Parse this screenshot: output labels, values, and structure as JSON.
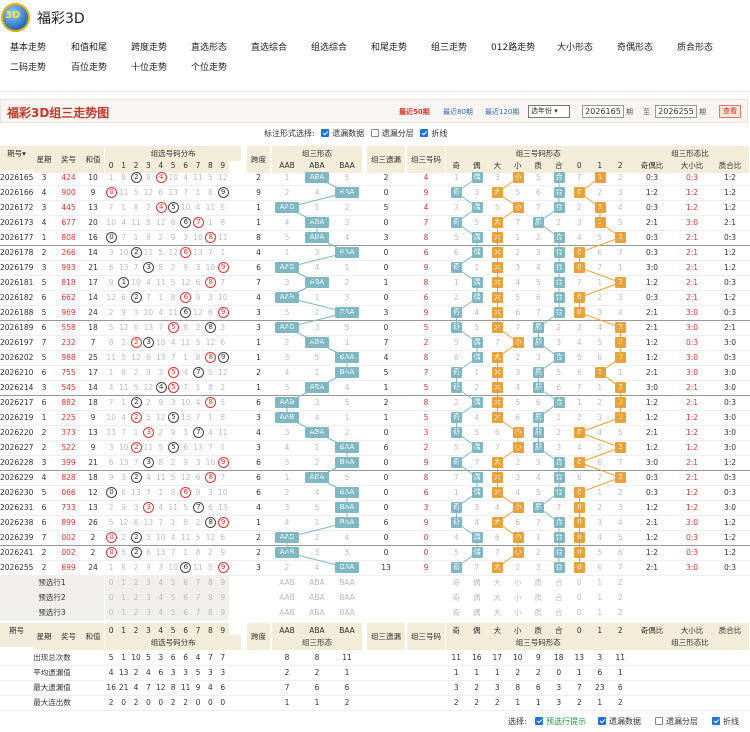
{
  "app": {
    "logo_text": "3D",
    "title": "福彩3D"
  },
  "nav": [
    [
      "基本走势",
      10,
      0
    ],
    [
      "和值和尾",
      71,
      0
    ],
    [
      "跨度走势",
      131,
      0
    ],
    [
      "直选形态",
      191,
      0
    ],
    [
      "直选综合",
      251,
      0
    ],
    [
      "组选综合",
      311,
      0
    ],
    [
      "和尾走势",
      371,
      0
    ],
    [
      "组三走势",
      431,
      0
    ],
    [
      "012路走势",
      491,
      0
    ],
    [
      "大小形态",
      557,
      0
    ],
    [
      "奇偶形态",
      617,
      0
    ],
    [
      "质合形态",
      677,
      0
    ],
    [
      "二码走势",
      10,
      1
    ],
    [
      "百位走势",
      71,
      1
    ],
    [
      "十位走势",
      131,
      1
    ],
    [
      "个位走势",
      191,
      1
    ]
  ],
  "toolbar": {
    "chart_title": "福彩3D组三走势图",
    "periods": [
      "最近50期",
      "最近80期",
      "最近120期"
    ],
    "year_select": "选年份",
    "from": "2026165",
    "to_label": "期",
    "between": "至",
    "to": "2026255",
    "end_label": "期",
    "query": "查看"
  },
  "options": {
    "label": "标注形式选择:",
    "items": [
      {
        "label": "遗漏数据",
        "on": true
      },
      {
        "label": "遗漏分层",
        "on": false
      },
      {
        "label": "折线",
        "on": true
      }
    ]
  },
  "headers": {
    "period": "期号",
    "week": "星期",
    "prize": "奖号",
    "sum": "和值",
    "dist": "组选号码分布",
    "span": "跨度",
    "shape": "组三形态",
    "shape_cols": [
      "AAB",
      "ABA",
      "BAA"
    ],
    "omit": "组三遗漏",
    "code": "组三号码",
    "code_shape": "组三号码形态",
    "code_cols": [
      "奇",
      "偶",
      "大",
      "小",
      "质",
      "合",
      "0",
      "1",
      "2"
    ],
    "ratio": "组三形态比",
    "ratio_cols": [
      "奇偶比",
      "大小比",
      "质合比"
    ]
  },
  "rows": [
    [
      "2026165",
      "3",
      "424",
      "10",
      "2",
      "ABA",
      "2",
      "4",
      "0:3",
      "0:3",
      "1:2"
    ],
    [
      "2026166",
      "4",
      "900",
      "9",
      "9",
      "BAA",
      "0",
      "9",
      "1:2",
      "1:2",
      "1:2"
    ],
    [
      "2026172",
      "3",
      "445",
      "13",
      "1",
      "AAB",
      "5",
      "4",
      "0:3",
      "1:2",
      "1:2"
    ],
    [
      "2026173",
      "4",
      "677",
      "20",
      "1",
      "ABA",
      "0",
      "7",
      "2:1",
      "3:0",
      "2:1"
    ],
    [
      "2026177",
      "1",
      "808",
      "16",
      "8",
      "ABA",
      "3",
      "8",
      "0:3",
      "2:1",
      "0:3"
    ],
    [
      "2026178",
      "2",
      "266",
      "14",
      "4",
      "BAA",
      "0",
      "6",
      "0:3",
      "2:1",
      "1:2"
    ],
    [
      "2026179",
      "3",
      "993",
      "21",
      "6",
      "AAB",
      "0",
      "9",
      "3:0",
      "2:1",
      "1:2"
    ],
    [
      "2026181",
      "5",
      "818",
      "17",
      "7",
      "ABA",
      "1",
      "8",
      "1:2",
      "2:1",
      "0:3"
    ],
    [
      "2026182",
      "6",
      "662",
      "14",
      "4",
      "AAB",
      "0",
      "6",
      "0:3",
      "2:1",
      "1:2"
    ],
    [
      "2026188",
      "5",
      "969",
      "24",
      "3",
      "BAA",
      "3",
      "9",
      "2:1",
      "3:0",
      "0:3"
    ],
    [
      "2026189",
      "6",
      "558",
      "18",
      "3",
      "AAB",
      "0",
      "5",
      "2:1",
      "3:0",
      "2:1"
    ],
    [
      "2026197",
      "7",
      "232",
      "7",
      "1",
      "ABA",
      "7",
      "2",
      "1:2",
      "0:3",
      "3:0"
    ],
    [
      "2026202",
      "5",
      "988",
      "25",
      "1",
      "BAA",
      "4",
      "8",
      "1:2",
      "3:0",
      "0:3"
    ],
    [
      "2026210",
      "6",
      "755",
      "17",
      "2",
      "BAA",
      "5",
      "7",
      "2:1",
      "3:0",
      "3:0"
    ],
    [
      "2026214",
      "3",
      "545",
      "14",
      "1",
      "ABA",
      "1",
      "5",
      "3:0",
      "2:1",
      "3:0"
    ],
    [
      "2026217",
      "6",
      "882",
      "18",
      "6",
      "AAB",
      "2",
      "8",
      "1:2",
      "2:1",
      "0:3"
    ],
    [
      "2026219",
      "1",
      "225",
      "9",
      "3",
      "AAB",
      "1",
      "5",
      "1:2",
      "1:2",
      "3:0"
    ],
    [
      "2026220",
      "2",
      "373",
      "13",
      "4",
      "ABA",
      "0",
      "3",
      "2:1",
      "1:2",
      "3:0"
    ],
    [
      "2026227",
      "2",
      "522",
      "9",
      "3",
      "BAA",
      "6",
      "2",
      "1:2",
      "1:2",
      "3:0"
    ],
    [
      "2026228",
      "3",
      "399",
      "21",
      "6",
      "BAA",
      "0",
      "9",
      "3:0",
      "2:1",
      "1:2"
    ],
    [
      "2026229",
      "4",
      "828",
      "18",
      "6",
      "ABA",
      "0",
      "8",
      "0:3",
      "2:1",
      "0:3"
    ],
    [
      "2026230",
      "5",
      "066",
      "12",
      "6",
      "BAA",
      "0",
      "6",
      "0:3",
      "1:2",
      "0:3"
    ],
    [
      "2026231",
      "6",
      "733",
      "13",
      "4",
      "BAA",
      "0",
      "3",
      "1:2",
      "1:2",
      "3:0"
    ],
    [
      "2026238",
      "6",
      "899",
      "26",
      "1",
      "BAA",
      "6",
      "9",
      "2:1",
      "3:0",
      "1:2"
    ],
    [
      "2026239",
      "7",
      "002",
      "2",
      "2",
      "AAB",
      "0",
      "0",
      "1:2",
      "0:3",
      "1:2"
    ],
    [
      "2026241",
      "2",
      "002",
      "2",
      "2",
      "AAB",
      "0",
      "0",
      "1:2",
      "0:3",
      "1:2"
    ],
    [
      "2026255",
      "2",
      "699",
      "24",
      "3",
      "BAA",
      "13",
      "9",
      "2:1",
      "3:0",
      "0:3"
    ]
  ],
  "pre": [
    "预选行1",
    "预选行2",
    "预选行3"
  ],
  "stats": {
    "labels": [
      "出现总次数",
      "平均遗漏值",
      "最大遗漏值",
      "最大连出数"
    ],
    "dist": [
      [
        "5",
        "1",
        "10",
        "5",
        "3",
        "6",
        "6",
        "4",
        "7",
        "7"
      ],
      [
        "4",
        "13",
        "2",
        "4",
        "6",
        "3",
        "3",
        "5",
        "3",
        "3"
      ],
      [
        "16",
        "21",
        "4",
        "7",
        "12",
        "8",
        "11",
        "9",
        "4",
        "6"
      ],
      [
        "2",
        "0",
        "2",
        "0",
        "0",
        "2",
        "2",
        "0",
        "0",
        "0"
      ]
    ],
    "shape": [
      [
        "8",
        "8",
        "11"
      ],
      [
        "2",
        "2",
        "1"
      ],
      [
        "7",
        "6",
        "6"
      ],
      [
        "1",
        "1",
        "2"
      ]
    ],
    "code": [
      [
        "11",
        "16",
        "17",
        "10",
        "9",
        "18",
        "13",
        "3",
        "11"
      ],
      [
        "1",
        "1",
        "1",
        "2",
        "2",
        "0",
        "1",
        "6",
        "1"
      ],
      [
        "3",
        "2",
        "3",
        "8",
        "6",
        "3",
        "7",
        "23",
        "6"
      ],
      [
        "2",
        "2",
        "2",
        "1",
        "1",
        "3",
        "2",
        "1",
        "2"
      ]
    ]
  },
  "footer": {
    "label": "选择:",
    "items": [
      {
        "label": "预选行提示",
        "on": true,
        "green": true
      },
      {
        "label": "遗漏数据",
        "on": true
      },
      {
        "label": "遗漏分层",
        "on": false
      },
      {
        "label": "折线",
        "on": true
      }
    ]
  },
  "colors": {
    "header_bg": "#f3ecd9",
    "accent_red": "#c0392b",
    "teal": "#7fb8c3",
    "orange": "#e8a23a"
  }
}
